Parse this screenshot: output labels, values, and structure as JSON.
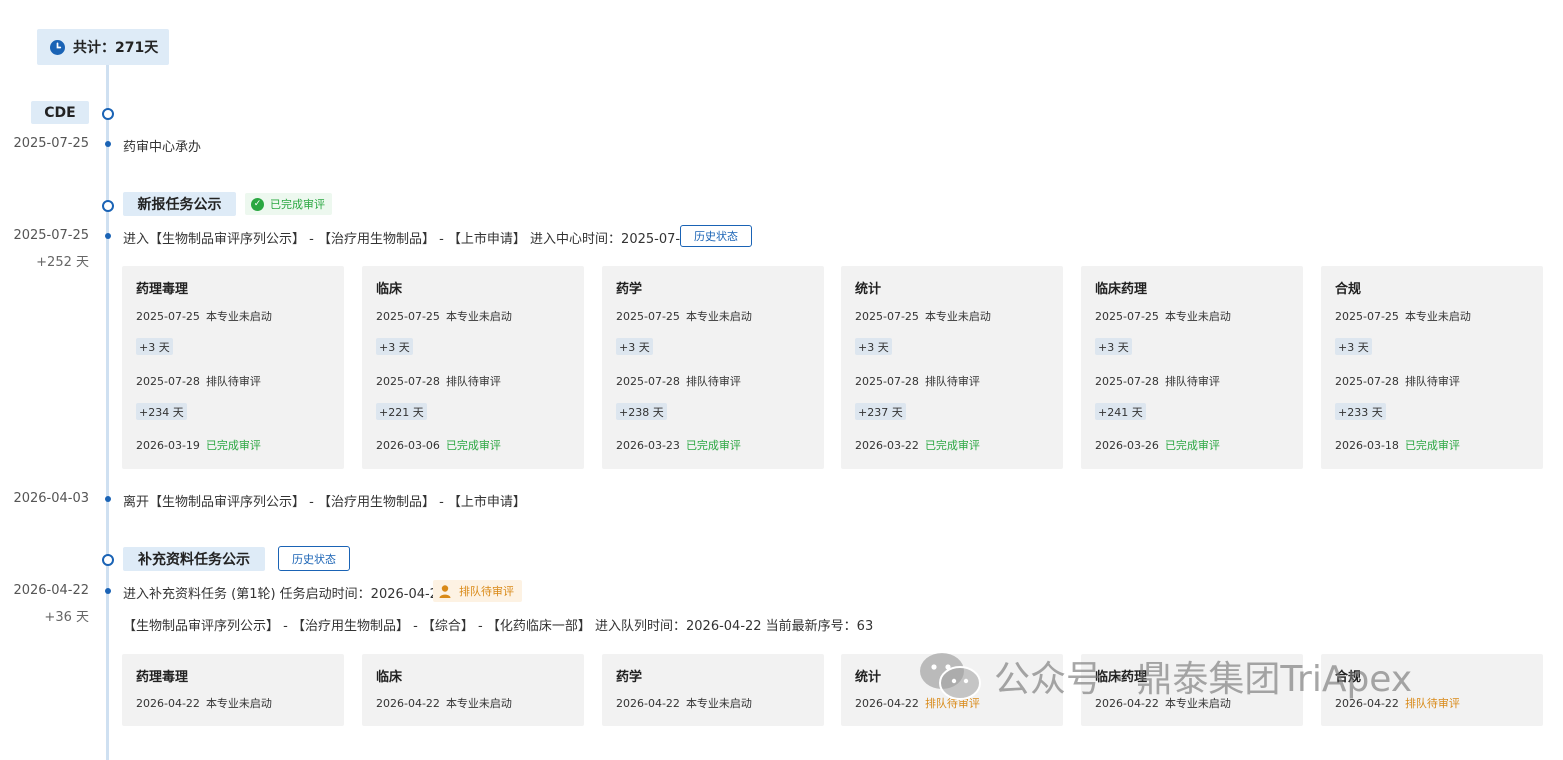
{
  "total": {
    "label": "共计：271天",
    "icon": "clock-icon"
  },
  "cde_label": "CDE",
  "events": {
    "accept": {
      "date": "2025-07-25",
      "text": "药审中心承办"
    },
    "new_task": {
      "title": "新报任务公示",
      "status": "已完成审评",
      "date": "2025-07-25",
      "days": "+252 天",
      "text": "进入【生物制品审评序列公示】 - 【治疗用生物制品】 - 【上市申请】 进入中心时间：2025-07-25",
      "history_btn": "历史状态"
    },
    "leave": {
      "date": "2026-04-03",
      "text": "离开【生物制品审评序列公示】 - 【治疗用生物制品】 - 【上市申请】"
    },
    "supplement": {
      "title": "补充资料任务公示",
      "history_btn": "历史状态",
      "date": "2026-04-22",
      "days": "+36 天",
      "text": "进入补充资料任务 (第1轮) 任务启动时间：2026-04-22",
      "status": "排队待审评",
      "text2": "【生物制品审评序列公示】 - 【治疗用生物制品】 - 【综合】 - 【化药临床一部】 进入队列时间：2026-04-22 当前最新序号：63"
    }
  },
  "review_cards": [
    {
      "title": "药理毒理",
      "d1": "2025-07-25",
      "s1": "本专业未启动",
      "delta1": "+3 天",
      "d2": "2025-07-28",
      "s2": "排队待审评",
      "delta2": "+234 天",
      "d3": "2026-03-19",
      "s3": "已完成审评"
    },
    {
      "title": "临床",
      "d1": "2025-07-25",
      "s1": "本专业未启动",
      "delta1": "+3 天",
      "d2": "2025-07-28",
      "s2": "排队待审评",
      "delta2": "+221 天",
      "d3": "2026-03-06",
      "s3": "已完成审评"
    },
    {
      "title": "药学",
      "d1": "2025-07-25",
      "s1": "本专业未启动",
      "delta1": "+3 天",
      "d2": "2025-07-28",
      "s2": "排队待审评",
      "delta2": "+238 天",
      "d3": "2026-03-23",
      "s3": "已完成审评"
    },
    {
      "title": "统计",
      "d1": "2025-07-25",
      "s1": "本专业未启动",
      "delta1": "+3 天",
      "d2": "2025-07-28",
      "s2": "排队待审评",
      "delta2": "+237 天",
      "d3": "2026-03-22",
      "s3": "已完成审评"
    },
    {
      "title": "临床药理",
      "d1": "2025-07-25",
      "s1": "本专业未启动",
      "delta1": "+3 天",
      "d2": "2025-07-28",
      "s2": "排队待审评",
      "delta2": "+241 天",
      "d3": "2026-03-26",
      "s3": "已完成审评"
    },
    {
      "title": "合规",
      "d1": "2025-07-25",
      "s1": "本专业未启动",
      "delta1": "+3 天",
      "d2": "2025-07-28",
      "s2": "排队待审评",
      "delta2": "+233 天",
      "d3": "2026-03-18",
      "s3": "已完成审评"
    }
  ],
  "supplement_cards": [
    {
      "title": "药理毒理",
      "d1": "2026-04-22",
      "s1": "本专业未启动",
      "kind": "normal"
    },
    {
      "title": "临床",
      "d1": "2026-04-22",
      "s1": "本专业未启动",
      "kind": "normal"
    },
    {
      "title": "药学",
      "d1": "2026-04-22",
      "s1": "本专业未启动",
      "kind": "normal"
    },
    {
      "title": "统计",
      "d1": "2026-04-22",
      "s1": "排队待审评",
      "kind": "wait"
    },
    {
      "title": "临床药理",
      "d1": "2026-04-22",
      "s1": "本专业未启动",
      "kind": "normal"
    },
    {
      "title": "合规",
      "d1": "2026-04-22",
      "s1": "排队待审评",
      "kind": "wait"
    }
  ],
  "watermark": "公众号 · 鼎泰集团TriApex",
  "colors": {
    "accent": "#1a63b5",
    "success": "#2aa741",
    "warning": "#d98a18",
    "pill_bg": "#deebf7",
    "card_bg": "#f2f2f2"
  }
}
